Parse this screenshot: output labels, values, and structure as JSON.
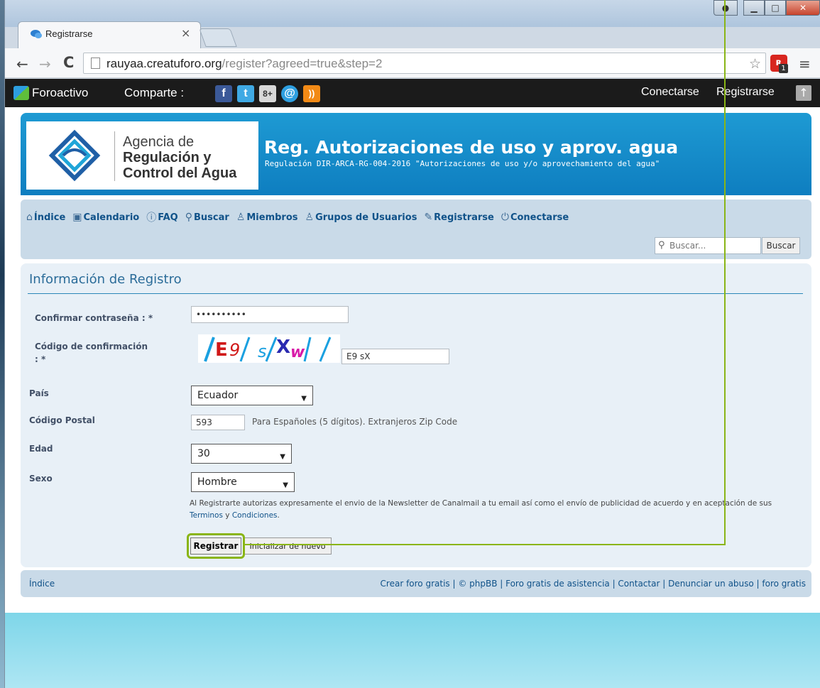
{
  "browser": {
    "tab_title": "Registrarse",
    "tab_close": "×",
    "url_host": "rauyaa.creatuforo.org",
    "url_path": "/register?agreed=true&step=2",
    "ext_badge": "1"
  },
  "forobar": {
    "brand": "Foroactivo",
    "share_label": "Comparte :",
    "conectarse": "Conectarse",
    "registrarse": "Registrarse"
  },
  "header": {
    "logo_line1": "Agencia de",
    "logo_line2": "Regulación y",
    "logo_line3": "Control del Agua",
    "title": "Reg. Autorizaciones de uso y aprov. agua",
    "description": "Regulación DIR-ARCA-RG-004-2016 \"Autorizaciones de uso y/o aprovechamiento del agua\""
  },
  "nav": {
    "items": [
      {
        "label": "Índice",
        "icon": "◯"
      },
      {
        "label": "Calendario",
        "icon": "▣"
      },
      {
        "label": "FAQ",
        "icon": "?"
      },
      {
        "label": "Buscar",
        "icon": "⚲"
      },
      {
        "label": "Miembros",
        "icon": "♁"
      },
      {
        "label": "Grupos de Usuarios",
        "icon": "♁"
      },
      {
        "label": "Registrarse",
        "icon": "✎"
      },
      {
        "label": "Conectarse",
        "icon": "⏻"
      }
    ],
    "search_placeholder": "Buscar...",
    "search_button": "Buscar"
  },
  "form": {
    "title": "Información de Registro",
    "confirm_password_label": "Confirmar contraseña : *",
    "confirm_password_value": "••••••••••",
    "captcha_label_line1": "Código de confirmación",
    "captcha_label_line2": ": *",
    "captcha_value": "E9 sX",
    "country_label": "País",
    "country_value": "Ecuador",
    "postal_label": "Código Postal",
    "postal_value": "593",
    "postal_hint": "Para Españoles (5 dígitos). Extranjeros Zip Code",
    "age_label": "Edad",
    "age_value": "30",
    "sex_label": "Sexo",
    "sex_value": "Hombre",
    "legal_text": "Al Registrarte autorizas expresamente el envio de la Newsletter de Canalmail a tu email así como el envío de publicidad de acuerdo y en aceptación de sus",
    "legal_terms": "Terminos",
    "legal_and": "y",
    "legal_conditions": "Condiciones",
    "submit_label": "Registrar",
    "reset_label": "Inicializar de nuevo"
  },
  "footer": {
    "index": "Índice",
    "links": "Crear foro gratis | © phpBB | Foro gratis de asistencia | Contactar | Denunciar un abuso | foro gratis"
  },
  "colors": {
    "banner": "#1e9ad3",
    "nav_bg": "#c9dae8",
    "link": "#105289",
    "highlight": "#8ab516"
  }
}
